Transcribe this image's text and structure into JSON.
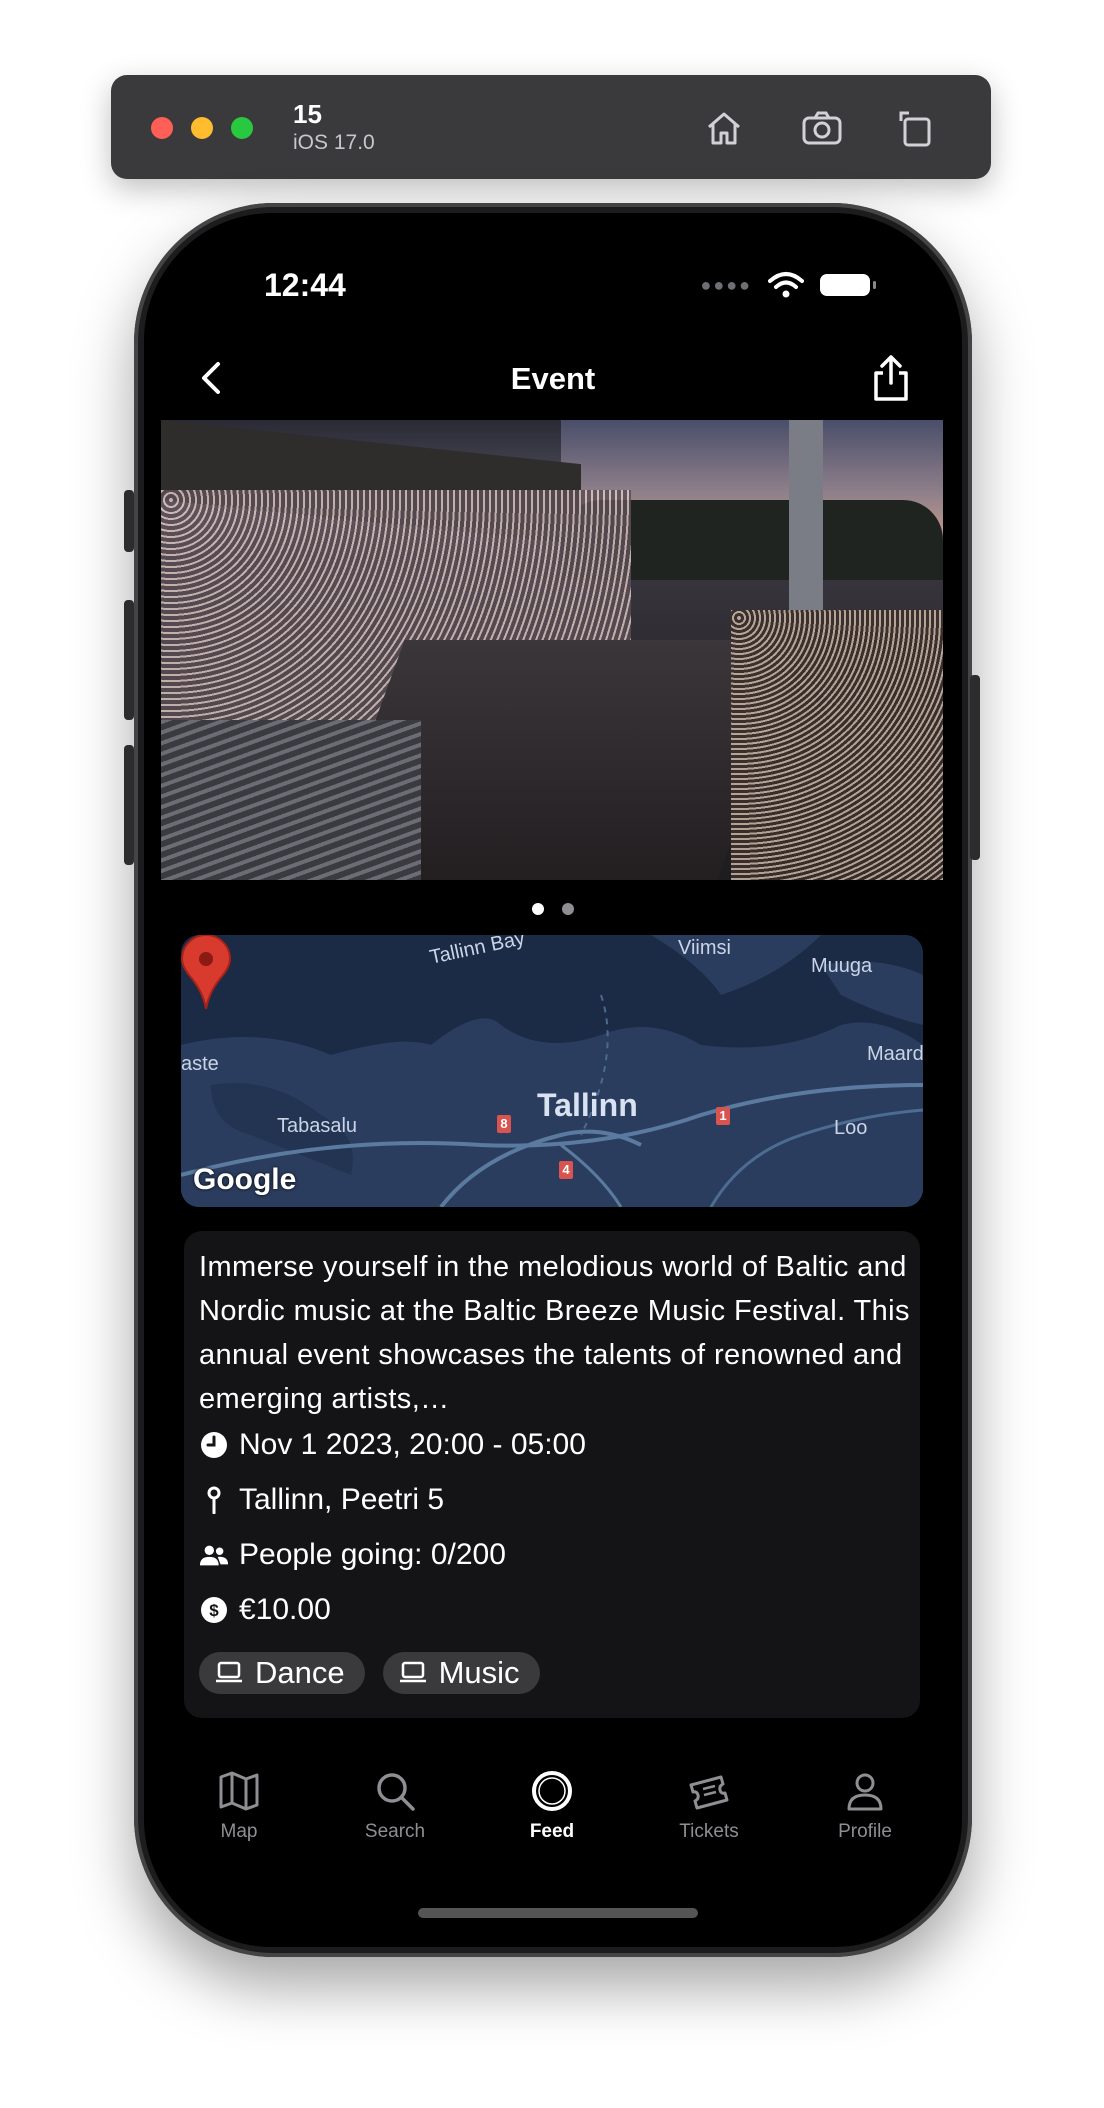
{
  "simulator": {
    "device": "15",
    "os": "iOS 17.0",
    "buttons": [
      "home-icon",
      "screenshot-icon",
      "rotate-icon"
    ]
  },
  "status_bar": {
    "time": "12:44",
    "icons": [
      "signal-dots",
      "wifi-icon",
      "battery-icon"
    ]
  },
  "nav": {
    "title": "Event",
    "back_icon": "chevron-left-icon",
    "share_icon": "share-icon"
  },
  "gallery": {
    "page_count": 2,
    "current_page": 1
  },
  "map": {
    "labels": {
      "viimsi": "Viimsi",
      "tallinn_bay": "Tallinn Bay",
      "muuga": "Muuga",
      "maardu": "Maard",
      "aste": "aste",
      "tabasalu": "Tabasalu",
      "loo": "Loo",
      "city": "Tallinn"
    },
    "road_shields": [
      "8",
      "4",
      "1"
    ],
    "attribution": "Google"
  },
  "event": {
    "description": "Immerse yourself in the melodious world of Baltic and Nordic music at the Baltic Breeze Music Festival. This annual event showcases the talents of renowned and emerging artists,…",
    "datetime": "Nov 1 2023, 20:00 - 05:00",
    "location": "Tallinn, Peetri 5",
    "attendance": "People going: 0/200",
    "price": "€10.00",
    "tags": [
      "Dance",
      "Music"
    ]
  },
  "tabbar": {
    "items": [
      {
        "label": "Map",
        "icon": "map-icon"
      },
      {
        "label": "Search",
        "icon": "search-icon"
      },
      {
        "label": "Feed",
        "icon": "feed-icon"
      },
      {
        "label": "Tickets",
        "icon": "tickets-icon"
      },
      {
        "label": "Profile",
        "icon": "profile-icon"
      }
    ],
    "active": "Feed"
  },
  "colors": {
    "background": "#000000",
    "card": "#141416",
    "tag": "#3a3a3c",
    "inactive_tab": "#8e8e93",
    "pin": "#d93a2e"
  }
}
